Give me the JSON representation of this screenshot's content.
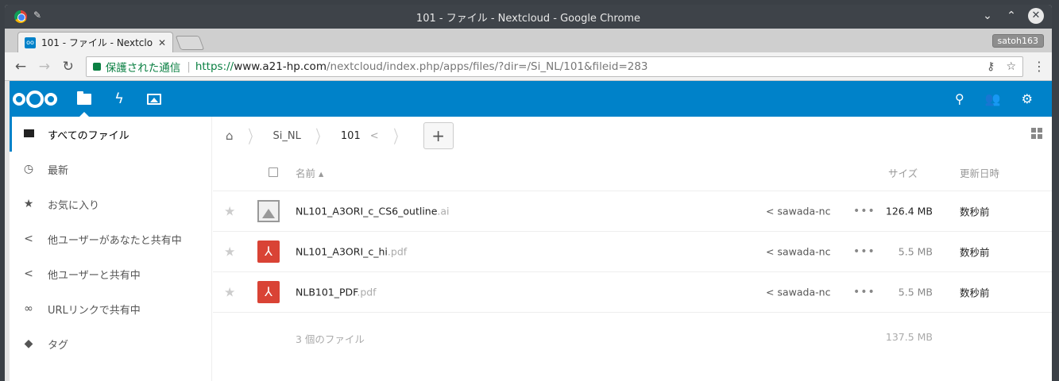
{
  "window": {
    "title": "101 - ファイル - Nextcloud - Google Chrome",
    "controls": [
      "minimize",
      "maximize",
      "close"
    ]
  },
  "tabs": [
    {
      "title": "101 - ファイル - Nextcloud"
    }
  ],
  "profile_label": "satoh163",
  "address_bar": {
    "security_text": "保護された通信",
    "scheme": "https://",
    "host": "www.a21-hp.com",
    "path": "/nextcloud/index.php/apps/files/?dir=/Si_NL/101&fileid=283"
  },
  "header": {
    "apps": [
      {
        "name": "files",
        "icon": "folder-icon",
        "active": true
      },
      {
        "name": "activity",
        "icon": "lightning-icon"
      },
      {
        "name": "gallery",
        "icon": "image-icon"
      }
    ],
    "right_icons": [
      "search-icon",
      "contacts-icon",
      "settings-icon"
    ]
  },
  "sidebar": {
    "items": [
      {
        "label": "すべてのファイル",
        "icon": "folder-icon",
        "active": true
      },
      {
        "label": "最新",
        "icon": "clock-icon"
      },
      {
        "label": "お気に入り",
        "icon": "star-icon"
      },
      {
        "label": "他ユーザーがあなたと共有中",
        "icon": "share-icon"
      },
      {
        "label": "他ユーザーと共有中",
        "icon": "share-icon"
      },
      {
        "label": "URLリンクで共有中",
        "icon": "link-icon"
      },
      {
        "label": "タグ",
        "icon": "tag-icon"
      }
    ]
  },
  "breadcrumb": {
    "items": [
      "Si_NL",
      "101"
    ]
  },
  "table": {
    "headers": {
      "name": "名前",
      "size": "サイズ",
      "modified": "更新日時"
    },
    "rows": [
      {
        "name": "NL101_A3ORI_c_CS6_outline",
        "ext": ".ai",
        "type": "image",
        "shared_by": "sawada-nc",
        "size": "126.4 MB",
        "modified": "数秒前"
      },
      {
        "name": "NL101_A3ORI_c_hi",
        "ext": ".pdf",
        "type": "pdf",
        "shared_by": "sawada-nc",
        "size": "5.5 MB",
        "modified": "数秒前"
      },
      {
        "name": "NLB101_PDF",
        "ext": ".pdf",
        "type": "pdf",
        "shared_by": "sawada-nc",
        "size": "5.5 MB",
        "modified": "数秒前"
      }
    ],
    "summary": {
      "count": "3 個のファイル",
      "total": "137.5 MB"
    }
  }
}
